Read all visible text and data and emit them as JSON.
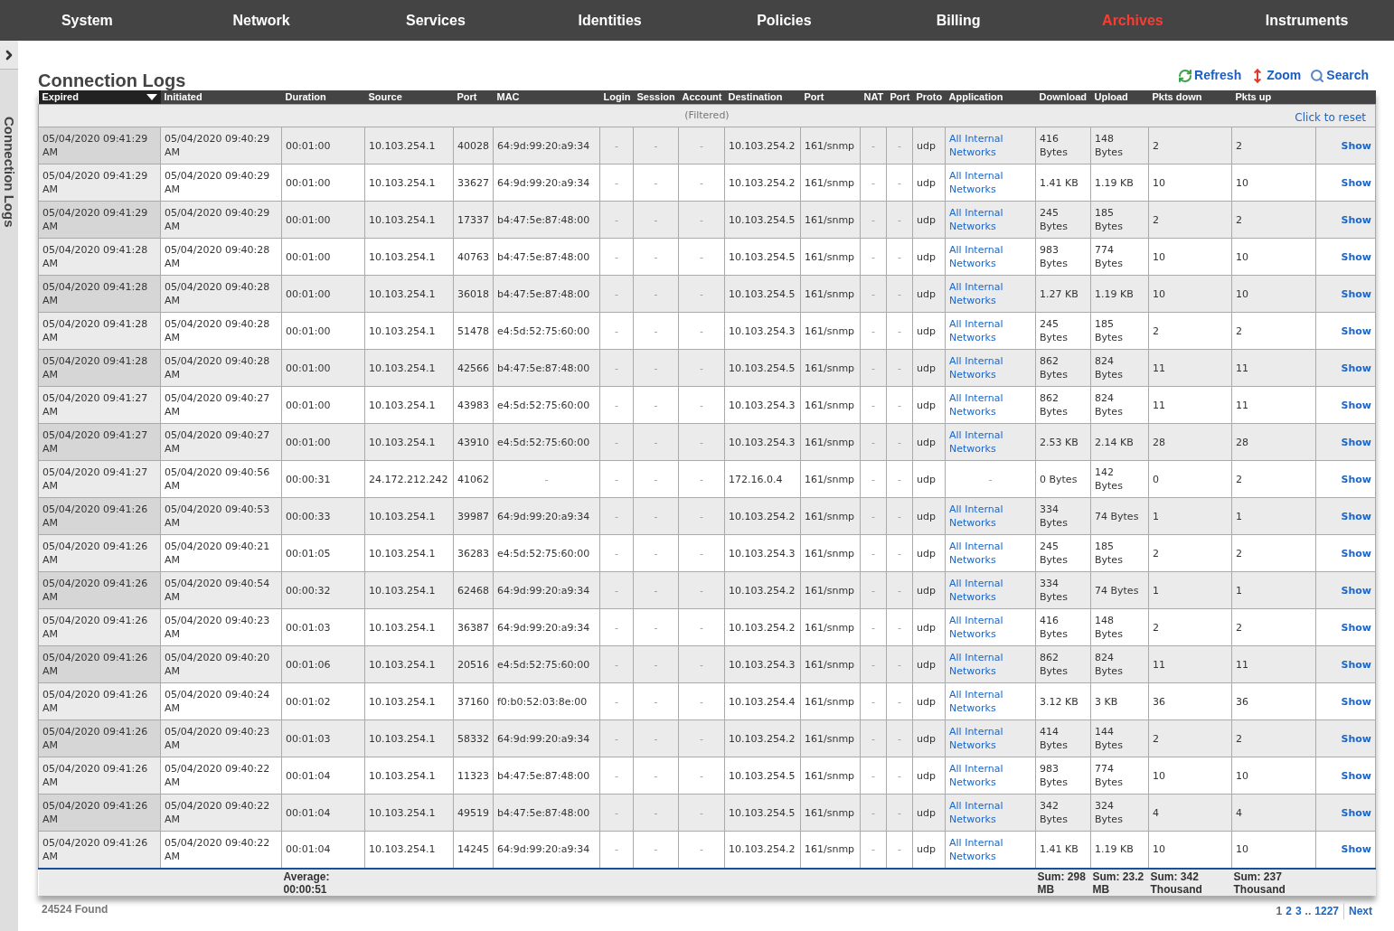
{
  "nav": [
    {
      "label": "System",
      "selected": false
    },
    {
      "label": "Network",
      "selected": false
    },
    {
      "label": "Services",
      "selected": false
    },
    {
      "label": "Identities",
      "selected": false
    },
    {
      "label": "Policies",
      "selected": false
    },
    {
      "label": "Billing",
      "selected": false
    },
    {
      "label": "Archives",
      "selected": true
    },
    {
      "label": "Instruments",
      "selected": false
    }
  ],
  "sidebar": {
    "label": "Connection Logs"
  },
  "title": "Connection Logs",
  "toolbar": [
    {
      "kind": "refresh",
      "label": "Refresh"
    },
    {
      "kind": "zoom",
      "label": "Zoom"
    },
    {
      "kind": "search",
      "label": "Search"
    }
  ],
  "filter": {
    "status": "(Filtered)",
    "reset": "Click to reset"
  },
  "columns": [
    {
      "label": "Expired",
      "kind": "text",
      "sorted": true
    },
    {
      "label": "Initiated",
      "kind": "text",
      "sorted": false
    },
    {
      "label": "Duration",
      "kind": "text",
      "sorted": false,
      "total": "Average: 00:00:51"
    },
    {
      "label": "Source",
      "kind": "text",
      "sorted": false
    },
    {
      "label": "Port",
      "kind": "text",
      "sorted": false
    },
    {
      "label": "MAC",
      "kind": "text",
      "sorted": false
    },
    {
      "label": "Login",
      "kind": "empty",
      "sorted": false
    },
    {
      "label": "Session",
      "kind": "empty",
      "sorted": false
    },
    {
      "label": "Account",
      "kind": "empty",
      "sorted": false
    },
    {
      "label": "Destination",
      "kind": "text",
      "sorted": false
    },
    {
      "label": "Port",
      "kind": "text",
      "sorted": false
    },
    {
      "label": "NAT",
      "kind": "empty",
      "sorted": false
    },
    {
      "label": "Port",
      "kind": "empty",
      "sorted": false
    },
    {
      "label": "Proto",
      "kind": "text",
      "sorted": false
    },
    {
      "label": "Application",
      "kind": "link",
      "sorted": false
    },
    {
      "label": "Download",
      "kind": "text",
      "sorted": false,
      "total": "Sum: 298 MB"
    },
    {
      "label": "Upload",
      "kind": "text",
      "sorted": false,
      "total": "Sum: 23.2 MB"
    },
    {
      "label": "Pkts down",
      "kind": "text",
      "sorted": false,
      "total": "Sum: 342 Thousand"
    },
    {
      "label": "Pkts up",
      "kind": "text",
      "sorted": false,
      "total": "Sum: 237 Thousand"
    },
    {
      "kind": "action",
      "sorted": false
    }
  ],
  "rows": [
    [
      "05/04/2020 09:41:29 AM",
      "05/04/2020 09:40:29 AM",
      "00:01:00",
      "10.103.254.1",
      "40028",
      "64:9d:99:20:a9:34",
      "-",
      "-",
      "-",
      "10.103.254.2",
      "161/snmp",
      "-",
      "-",
      "udp",
      "All Internal Networks",
      "416 Bytes",
      "148 Bytes",
      "2",
      "2",
      "Show"
    ],
    [
      "05/04/2020 09:41:29 AM",
      "05/04/2020 09:40:29 AM",
      "00:01:00",
      "10.103.254.1",
      "33627",
      "64:9d:99:20:a9:34",
      "-",
      "-",
      "-",
      "10.103.254.2",
      "161/snmp",
      "-",
      "-",
      "udp",
      "All Internal Networks",
      "1.41 KB",
      "1.19 KB",
      "10",
      "10",
      "Show"
    ],
    [
      "05/04/2020 09:41:29 AM",
      "05/04/2020 09:40:29 AM",
      "00:01:00",
      "10.103.254.1",
      "17337",
      "b4:47:5e:87:48:00",
      "-",
      "-",
      "-",
      "10.103.254.5",
      "161/snmp",
      "-",
      "-",
      "udp",
      "All Internal Networks",
      "245 Bytes",
      "185 Bytes",
      "2",
      "2",
      "Show"
    ],
    [
      "05/04/2020 09:41:28 AM",
      "05/04/2020 09:40:28 AM",
      "00:01:00",
      "10.103.254.1",
      "40763",
      "b4:47:5e:87:48:00",
      "-",
      "-",
      "-",
      "10.103.254.5",
      "161/snmp",
      "-",
      "-",
      "udp",
      "All Internal Networks",
      "983 Bytes",
      "774 Bytes",
      "10",
      "10",
      "Show"
    ],
    [
      "05/04/2020 09:41:28 AM",
      "05/04/2020 09:40:28 AM",
      "00:01:00",
      "10.103.254.1",
      "36018",
      "b4:47:5e:87:48:00",
      "-",
      "-",
      "-",
      "10.103.254.5",
      "161/snmp",
      "-",
      "-",
      "udp",
      "All Internal Networks",
      "1.27 KB",
      "1.19 KB",
      "10",
      "10",
      "Show"
    ],
    [
      "05/04/2020 09:41:28 AM",
      "05/04/2020 09:40:28 AM",
      "00:01:00",
      "10.103.254.1",
      "51478",
      "e4:5d:52:75:60:00",
      "-",
      "-",
      "-",
      "10.103.254.3",
      "161/snmp",
      "-",
      "-",
      "udp",
      "All Internal Networks",
      "245 Bytes",
      "185 Bytes",
      "2",
      "2",
      "Show"
    ],
    [
      "05/04/2020 09:41:28 AM",
      "05/04/2020 09:40:28 AM",
      "00:01:00",
      "10.103.254.1",
      "42566",
      "b4:47:5e:87:48:00",
      "-",
      "-",
      "-",
      "10.103.254.5",
      "161/snmp",
      "-",
      "-",
      "udp",
      "All Internal Networks",
      "862 Bytes",
      "824 Bytes",
      "11",
      "11",
      "Show"
    ],
    [
      "05/04/2020 09:41:27 AM",
      "05/04/2020 09:40:27 AM",
      "00:01:00",
      "10.103.254.1",
      "43983",
      "e4:5d:52:75:60:00",
      "-",
      "-",
      "-",
      "10.103.254.3",
      "161/snmp",
      "-",
      "-",
      "udp",
      "All Internal Networks",
      "862 Bytes",
      "824 Bytes",
      "11",
      "11",
      "Show"
    ],
    [
      "05/04/2020 09:41:27 AM",
      "05/04/2020 09:40:27 AM",
      "00:01:00",
      "10.103.254.1",
      "43910",
      "e4:5d:52:75:60:00",
      "-",
      "-",
      "-",
      "10.103.254.3",
      "161/snmp",
      "-",
      "-",
      "udp",
      "All Internal Networks",
      "2.53 KB",
      "2.14 KB",
      "28",
      "28",
      "Show"
    ],
    [
      "05/04/2020 09:41:27 AM",
      "05/04/2020 09:40:56 AM",
      "00:00:31",
      "24.172.212.242",
      "41062",
      {
        "text": "-",
        "kind": "empty"
      },
      "-",
      "-",
      "-",
      "172.16.0.4",
      "161/snmp",
      "-",
      "-",
      "udp",
      {
        "text": "-",
        "kind": "empty"
      },
      "0 Bytes",
      "142 Bytes",
      "0",
      "2",
      "Show"
    ],
    [
      "05/04/2020 09:41:26 AM",
      "05/04/2020 09:40:53 AM",
      "00:00:33",
      "10.103.254.1",
      "39987",
      "64:9d:99:20:a9:34",
      "-",
      "-",
      "-",
      "10.103.254.2",
      "161/snmp",
      "-",
      "-",
      "udp",
      "All Internal Networks",
      "334 Bytes",
      "74 Bytes",
      "1",
      "1",
      "Show"
    ],
    [
      "05/04/2020 09:41:26 AM",
      "05/04/2020 09:40:21 AM",
      "00:01:05",
      "10.103.254.1",
      "36283",
      "e4:5d:52:75:60:00",
      "-",
      "-",
      "-",
      "10.103.254.3",
      "161/snmp",
      "-",
      "-",
      "udp",
      "All Internal Networks",
      "245 Bytes",
      "185 Bytes",
      "2",
      "2",
      "Show"
    ],
    [
      "05/04/2020 09:41:26 AM",
      "05/04/2020 09:40:54 AM",
      "00:00:32",
      "10.103.254.1",
      "62468",
      "64:9d:99:20:a9:34",
      "-",
      "-",
      "-",
      "10.103.254.2",
      "161/snmp",
      "-",
      "-",
      "udp",
      "All Internal Networks",
      "334 Bytes",
      "74 Bytes",
      "1",
      "1",
      "Show"
    ],
    [
      "05/04/2020 09:41:26 AM",
      "05/04/2020 09:40:23 AM",
      "00:01:03",
      "10.103.254.1",
      "36387",
      "64:9d:99:20:a9:34",
      "-",
      "-",
      "-",
      "10.103.254.2",
      "161/snmp",
      "-",
      "-",
      "udp",
      "All Internal Networks",
      "416 Bytes",
      "148 Bytes",
      "2",
      "2",
      "Show"
    ],
    [
      "05/04/2020 09:41:26 AM",
      "05/04/2020 09:40:20 AM",
      "00:01:06",
      "10.103.254.1",
      "20516",
      "e4:5d:52:75:60:00",
      "-",
      "-",
      "-",
      "10.103.254.3",
      "161/snmp",
      "-",
      "-",
      "udp",
      "All Internal Networks",
      "862 Bytes",
      "824 Bytes",
      "11",
      "11",
      "Show"
    ],
    [
      "05/04/2020 09:41:26 AM",
      "05/04/2020 09:40:24 AM",
      "00:01:02",
      "10.103.254.1",
      "37160",
      "f0:b0:52:03:8e:00",
      "-",
      "-",
      "-",
      "10.103.254.4",
      "161/snmp",
      "-",
      "-",
      "udp",
      "All Internal Networks",
      "3.12 KB",
      "3 KB",
      "36",
      "36",
      "Show"
    ],
    [
      "05/04/2020 09:41:26 AM",
      "05/04/2020 09:40:23 AM",
      "00:01:03",
      "10.103.254.1",
      "58332",
      "64:9d:99:20:a9:34",
      "-",
      "-",
      "-",
      "10.103.254.2",
      "161/snmp",
      "-",
      "-",
      "udp",
      "All Internal Networks",
      "414 Bytes",
      "144 Bytes",
      "2",
      "2",
      "Show"
    ],
    [
      "05/04/2020 09:41:26 AM",
      "05/04/2020 09:40:22 AM",
      "00:01:04",
      "10.103.254.1",
      "11323",
      "b4:47:5e:87:48:00",
      "-",
      "-",
      "-",
      "10.103.254.5",
      "161/snmp",
      "-",
      "-",
      "udp",
      "All Internal Networks",
      "983 Bytes",
      "774 Bytes",
      "10",
      "10",
      "Show"
    ],
    [
      "05/04/2020 09:41:26 AM",
      "05/04/2020 09:40:22 AM",
      "00:01:04",
      "10.103.254.1",
      "49519",
      "b4:47:5e:87:48:00",
      "-",
      "-",
      "-",
      "10.103.254.5",
      "161/snmp",
      "-",
      "-",
      "udp",
      "All Internal Networks",
      "342 Bytes",
      "324 Bytes",
      "4",
      "4",
      "Show"
    ],
    [
      "05/04/2020 09:41:26 AM",
      "05/04/2020 09:40:22 AM",
      "00:01:04",
      "10.103.254.1",
      "14245",
      "64:9d:99:20:a9:34",
      "-",
      "-",
      "-",
      "10.103.254.2",
      "161/snmp",
      "-",
      "-",
      "udp",
      "All Internal Networks",
      "1.41 KB",
      "1.19 KB",
      "10",
      "10",
      "Show"
    ]
  ],
  "found": "24524 Found",
  "pagination": {
    "pages": [
      {
        "label": "1",
        "selected": true
      },
      {
        "label": "2",
        "selected": false
      },
      {
        "label": "3",
        "selected": false
      }
    ],
    "ellipsis": "..",
    "last": "1227",
    "next": "Next"
  }
}
